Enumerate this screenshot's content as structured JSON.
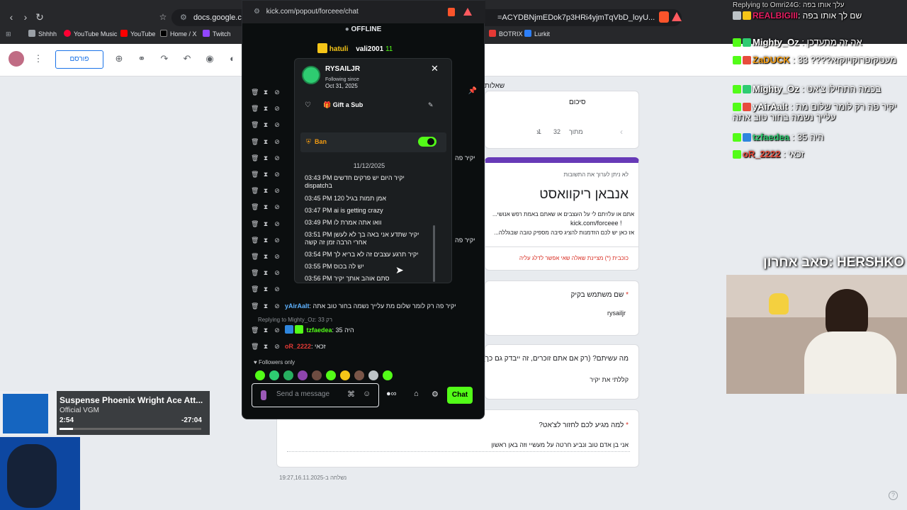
{
  "browser": {
    "url": "docs.google.com",
    "url_tail": "=ACYDBNjmEDok7p3HRi4yjmTqVbD_loyU...",
    "bookmarks": [
      "Shhhh",
      "YouTube Music",
      "YouTube",
      "Home / X",
      "Twitch",
      "BOTRIX",
      "Lurkit"
    ]
  },
  "forms": {
    "toolbar_label": "פורסם",
    "tab_questions": "שאלות",
    "summary_label": "סיכום",
    "page_of": "מתוך",
    "page_total": "32",
    "page_current": "1",
    "not_editable": "לא ניתן לערוך את התשובות",
    "title": "אנבאן ריקוואסט",
    "desc1": "אתם או על/יתם לי על העצבים או שאתם באמת רפש אנושי...",
    "desc2": "kick.com/forceee !",
    "desc3": "אז כאן יש לכם הזדמנות להציג סיבה מספיק טובה שבגללה...",
    "required_note": "כוכבית (*) מציינת שאלה שאי אפשר לדלג עליה",
    "q1": "שם משתמש בקיק",
    "a1": "rysailjr",
    "q2": "מה עשיתם? (רק אם אתם זוכרים, זה ייבדק גם כך)",
    "a2": "קללתי את יקיר",
    "q3": "למה מגיע לכם לחזור לצ'אט?",
    "a3": "אני בן אדם טוב ונביע חרטה על מעשיי וזה באן ראשון",
    "submitted": "נשלחה ב-19:27,16.11.2025"
  },
  "kick": {
    "url": "kick.com/popout/forceee/chat",
    "status": "OFFLINE",
    "pinned_user1": "hatuli",
    "pinned_user2": "vali2001",
    "pinned_count": "11",
    "card": {
      "username": "RYSAILJR",
      "following_since_label": "Following since",
      "following_since_date": "Oct 31, 2025",
      "gift_label": "Gift a Sub",
      "ban_label": "Ban",
      "date": "11/12/2025",
      "messages": [
        {
          "time": "03:43 PM",
          "text": "יקיר היום יש פרקים חדשים",
          "text2": "dispatchב"
        },
        {
          "time": "03:45 PM",
          "text": "אמן תמות בגיל 120"
        },
        {
          "time": "03:47 PM",
          "text": "ai is getting crazy"
        },
        {
          "time": "03:49 PM",
          "text": "וואו אתה אמרת לו"
        },
        {
          "time": "03:51 PM",
          "text": "יקיר שתדע אני באה בך לא לעשן",
          "text2": "אחרי הרבה זמן זה קשה"
        },
        {
          "time": "03:54 PM",
          "text": "יקיר תרגע עצבים זה לא בריא לך"
        },
        {
          "time": "03:55 PM",
          "text": "יש לה בכוס"
        },
        {
          "time": "03:56 PM",
          "text": "סתם אוהב אותך יקיר"
        }
      ]
    },
    "chat_tail1": "יקיר פה",
    "chat_tail2": "יקיר פה",
    "chat_msg_user": "yAirAalt",
    "chat_msg_text": "יקיר פה רק לומר שלום מת עלייך נשמה בחור טוב אתה",
    "replying_to": "Replying to Mighty_Oz: 33 רק",
    "chat2_user": "tzfaedea",
    "chat2_text": "היה 35",
    "chat3_user": "oR_2222",
    "chat3_text": "זכאי",
    "followers_only": "Followers only",
    "input_placeholder": "Send a message",
    "chat_button": "Chat"
  },
  "overlay": {
    "replying": "Replying to Omri24G: עלך אותו בפה",
    "topuser": "REALBIGIII",
    "topline": "שם לך אותו בפה",
    "rows": [
      {
        "user": "Mighty_Oz",
        "text": "אה זה מתעדכן",
        "color": "#2ecc71"
      },
      {
        "user": "ZaDUCK",
        "text": "33 ????מעטקזפרוקויוקזא",
        "color": "#f39c12"
      },
      {
        "user": "Mighty_Oz",
        "text": "בכמה התחילו צ'אט",
        "color": "#2ecc71"
      },
      {
        "user": "yAirAalt",
        "text": "יקיר פה רק לומר שלום מת",
        "text2": "עלייך נשמה בחור טוב אתה",
        "color": "#27ae60"
      },
      {
        "user": "tzfaedea",
        "text": "היה 35",
        "color": "#2ecc71"
      },
      {
        "user": "oR_2222",
        "text": "זכאי",
        "color": "#e74c3c"
      }
    ],
    "last_sub": "סאב אחרון: HERSHKO"
  },
  "music": {
    "title": "Suspense Phoenix Wright Ace Att...",
    "channel": "Official VGM",
    "elapsed": "2:54",
    "remaining": "-27:04"
  }
}
